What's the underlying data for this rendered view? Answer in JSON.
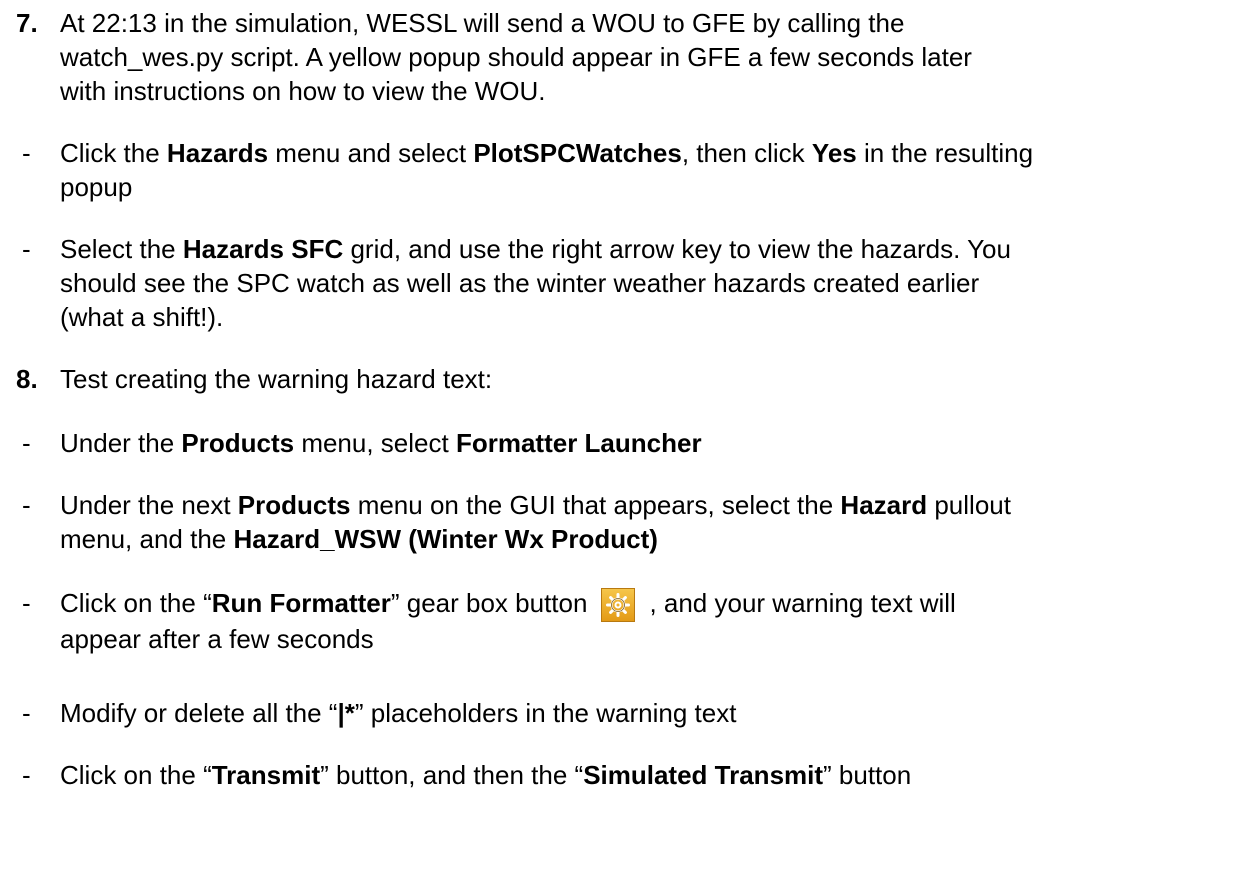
{
  "step7": {
    "number": "7.",
    "line1": "At 22:13 in the simulation, WESSL will send a WOU to GFE by calling the",
    "line2": "watch_wes.py script.  A yellow popup should appear in GFE a few seconds later",
    "line3": "with instructions on how to view the WOU.",
    "bullet1": {
      "dash": "-",
      "t1": "Click the ",
      "b1": "Hazards",
      "t2": " menu and select ",
      "b2": "PlotSPCWatches",
      "t3": ", then click ",
      "b3": "Yes",
      "t4": " in the resulting",
      "t5": "popup"
    },
    "bullet2": {
      "dash": "-",
      "t1": "Select the ",
      "b1": "Hazards SFC",
      "t2": " grid, and use the right arrow key to view the hazards.  You",
      "t3": "should see the SPC watch as well as the winter weather hazards created earlier",
      "t4": "(what a shift!)."
    }
  },
  "step8": {
    "number": "8.",
    "line1": "Test creating the warning hazard text:",
    "bullet1": {
      "dash": "-",
      "t1": "Under the ",
      "b1": "Products",
      "t2": " menu, select ",
      "b2": "Formatter Launcher"
    },
    "bullet2": {
      "dash": "-",
      "t1": "Under the next ",
      "b1": "Products",
      "t2": " menu on the GUI that appears, select the ",
      "b2": "Hazard",
      "t3": " pullout",
      "t4": "menu, and the ",
      "b3": "Hazard_WSW (Winter Wx Product)"
    },
    "bullet3": {
      "dash": "-",
      "t1": "Click on the “",
      "b1": "Run Formatter",
      "t2": "” gear box button",
      "t3": ", and your warning text will",
      "t4": "appear after a few seconds",
      "icon": "gear-icon"
    },
    "bullet4": {
      "dash": "-",
      "t1": "Modify or delete all the “",
      "b1": "|*",
      "t2": "” placeholders in the warning text"
    },
    "bullet5": {
      "dash": "-",
      "t1": "Click on the “",
      "b1": "Transmit",
      "t2": "” button, and then the “",
      "b2": "Simulated Transmit",
      "t3": "” button"
    }
  }
}
